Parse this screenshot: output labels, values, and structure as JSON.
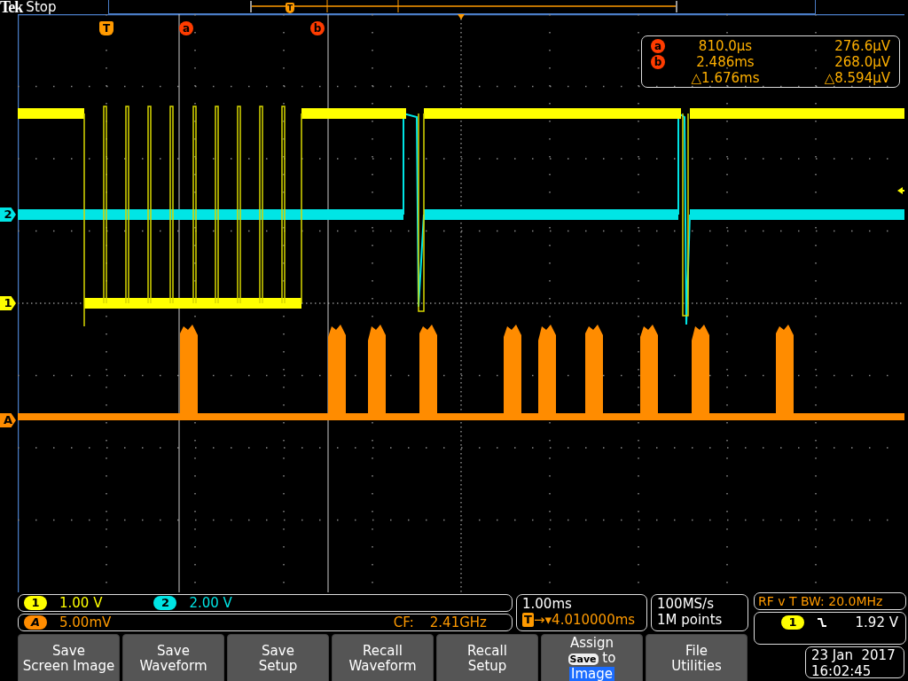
{
  "header": {
    "brand": "Tek",
    "run_state": "Stop"
  },
  "record_view": {
    "trigger_label": "T"
  },
  "graticule": {
    "top_markers": [
      {
        "kind": "trigger",
        "label": "T"
      },
      {
        "kind": "cursor",
        "label": "a"
      },
      {
        "kind": "cursor",
        "label": "b"
      }
    ],
    "channel_markers": [
      {
        "label": "2",
        "color": "#00e5e5"
      },
      {
        "label": "1",
        "color": "#ffff00"
      },
      {
        "label": "A",
        "color": "#ff8c00"
      }
    ]
  },
  "cursor_readout": {
    "rows": [
      {
        "marker": "a",
        "time": "810.0µs",
        "value": "276.6µV"
      },
      {
        "marker": "b",
        "time": "2.486ms",
        "value": "268.0µV"
      },
      {
        "time": "△1.676ms",
        "value": "△8.594µV"
      }
    ]
  },
  "channels": [
    {
      "label": "1",
      "scale": "1.00 V",
      "color": "#ffff00"
    },
    {
      "label": "2",
      "scale": "2.00 V",
      "color": "#00e5e5"
    }
  ],
  "rf": {
    "label": "A",
    "scale": "5.00mV",
    "cf_label": "CF:",
    "cf_value": "2.41GHz"
  },
  "horizontal": {
    "scale": "1.00ms",
    "trigger_label": "T",
    "position": "→▾4.010000ms"
  },
  "acquisition": {
    "sample_rate": "100MS/s",
    "record_length": "1M points"
  },
  "rf_status": "RF v T BW: 20.0MHz",
  "trigger": {
    "source": "1",
    "level": "1.92 V"
  },
  "timestamp": {
    "date": "23 Jan  2017",
    "time": "16:02:45"
  },
  "buttons": [
    {
      "kind": "plain",
      "lines": [
        "Save",
        "Screen Image"
      ]
    },
    {
      "kind": "plain",
      "lines": [
        "Save",
        "Waveform"
      ]
    },
    {
      "kind": "plain",
      "lines": [
        "Save",
        "Setup"
      ]
    },
    {
      "kind": "plain",
      "lines": [
        "Recall",
        "Waveform"
      ]
    },
    {
      "kind": "plain",
      "lines": [
        "Recall",
        "Setup"
      ]
    },
    {
      "kind": "assign",
      "lines": [
        "Assign"
      ],
      "key": "Save",
      "key_suffix": "to",
      "value": "Image"
    },
    {
      "kind": "plain",
      "lines": [
        "File",
        "Utilities"
      ]
    }
  ]
}
